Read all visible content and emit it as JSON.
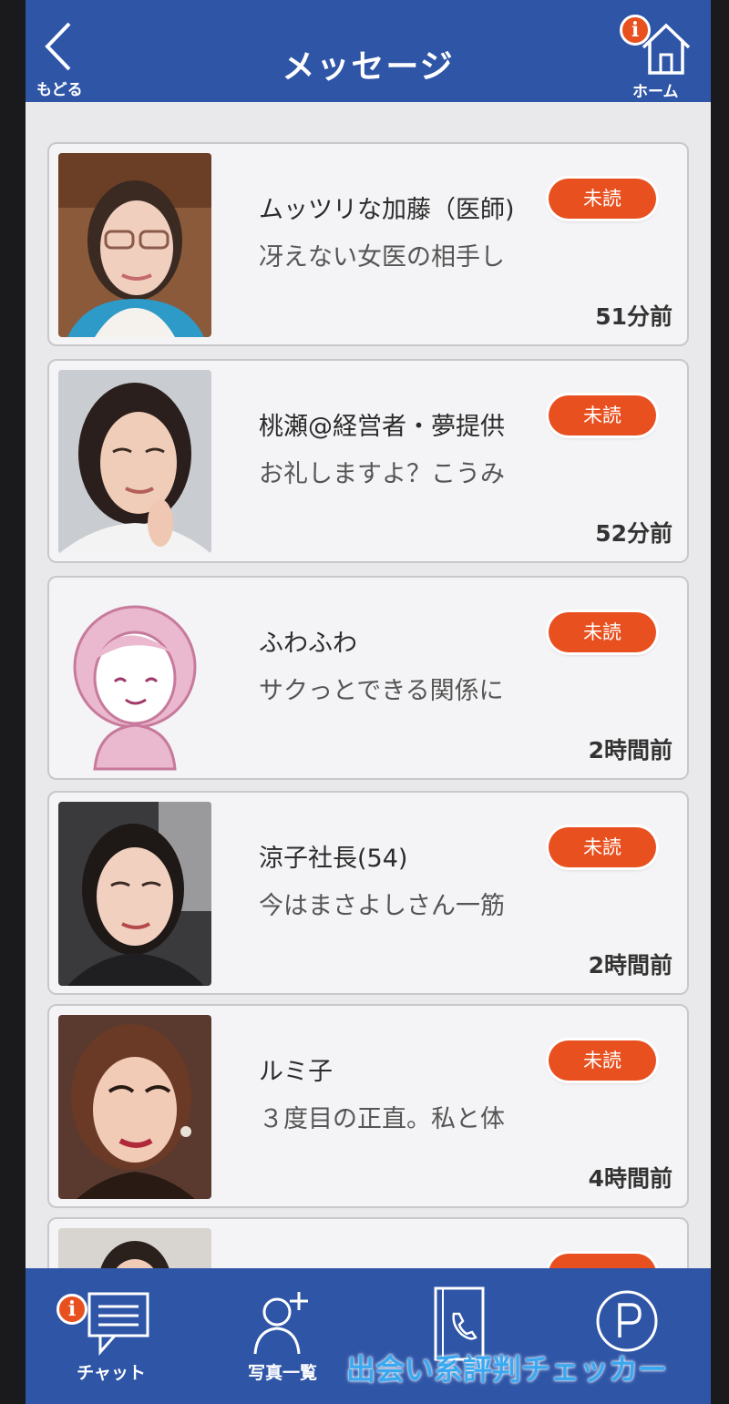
{
  "header": {
    "back_label": "もどる",
    "title": "メッセージ",
    "home_label": "ホーム",
    "info_mark": "i"
  },
  "messages": [
    {
      "name": "ムッツリな加藤（医師)",
      "preview": "冴えない女医の相手し",
      "status": "未読",
      "time": "51分前",
      "avatar": "photo"
    },
    {
      "name": "桃瀬@経営者・夢提供",
      "preview": "お礼しますよ？こうみ",
      "status": "未読",
      "time": "52分前",
      "avatar": "photo"
    },
    {
      "name": "ふわふわ",
      "preview": "サクっとできる関係に",
      "status": "未読",
      "time": "2時間前",
      "avatar": "default-female-illustration"
    },
    {
      "name": "涼子社長(54)",
      "preview": "今はまさよしさん一筋",
      "status": "未読",
      "time": "2時間前",
      "avatar": "photo"
    },
    {
      "name": "ルミ子",
      "preview": "３度目の正直。私と体",
      "status": "未読",
      "time": "4時間前",
      "avatar": "photo"
    }
  ],
  "tabs": [
    {
      "label": "チャット",
      "icon": "chat-icon"
    },
    {
      "label": "写真一覧",
      "icon": "add-user-icon"
    },
    {
      "label": "",
      "icon": "address-book-icon"
    },
    {
      "label": "",
      "icon": "points-icon"
    }
  ],
  "tab_info_mark": "i",
  "watermark": "出会い系評判チェッカー",
  "colors": {
    "header_bg": "#2f55a7",
    "badge": "#e8501f",
    "card_bg": "#f4f4f6",
    "watermark": "#3aa8f0"
  }
}
